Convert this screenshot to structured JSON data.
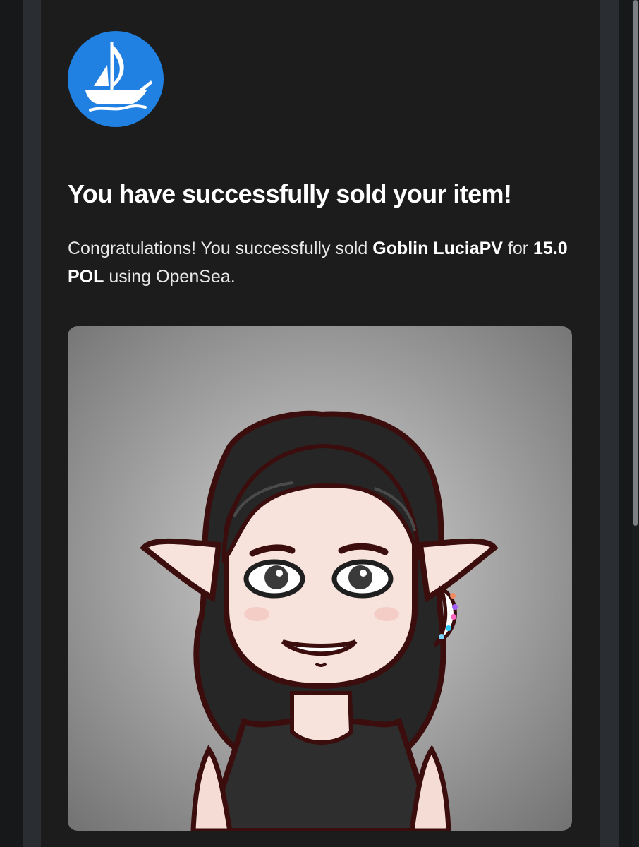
{
  "email": {
    "logo_icon": "opensea-ship-logo",
    "brand_color": "#2081e2",
    "headline": "You have successfully sold your item!",
    "message": {
      "intro": "Congratulations! You successfully sold ",
      "item_name": "Goblin LuciaPV",
      "connector": " for ",
      "price": "15.0 POL",
      "outro": " using OpenSea."
    },
    "nft_image_icon": "goblin-avatar-illustration"
  },
  "theme": {
    "background": "#1c1c1c",
    "headline_color": "#ffffff",
    "text_color": "#e8e8e8"
  }
}
